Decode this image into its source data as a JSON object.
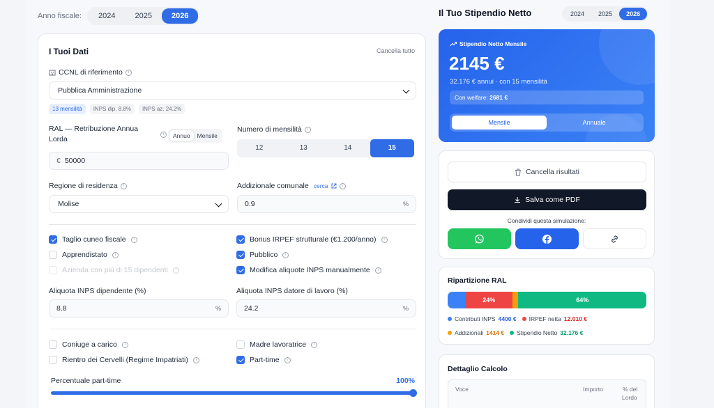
{
  "year_selector": {
    "label": "Anno fiscale:",
    "years": [
      "2024",
      "2025",
      "2026"
    ],
    "active": "2026"
  },
  "data_card": {
    "title": "I Tuoi Dati",
    "clear_all": "Cancella tutto",
    "ccnl": {
      "label": "CCNL di riferimento",
      "value": "Pubblica Amministrazione",
      "tags": [
        "13 mensilità",
        "INPS dip. 8.8%",
        "INPS az. 24.2%"
      ]
    },
    "ral": {
      "label_line1": "RAL — Retribuzione Annua",
      "label_line2": "Lorda",
      "toggle": [
        "Annuo",
        "Mensile"
      ],
      "active": "Annuo",
      "currency": "€",
      "value": "50000"
    },
    "mensilita": {
      "label": "Numero di mensilità",
      "options": [
        "12",
        "13",
        "14",
        "15"
      ],
      "active": "15"
    },
    "regione": {
      "label": "Regione di residenza",
      "value": "Molise"
    },
    "addizionale": {
      "label": "Addizionale comunale",
      "link": "cerca",
      "value": "0.9",
      "suffix": "%"
    },
    "checkboxes_a": [
      {
        "label": "Taglio cuneo fiscale",
        "checked": true
      },
      {
        "label": "Apprendistato",
        "checked": false
      },
      {
        "label": "Azienda con più di 15 dipendenti",
        "checked": false,
        "disabled": true
      },
      {
        "label": "Bonus IRPEF strutturale (€1.200/anno)",
        "checked": true
      },
      {
        "label": "Pubblico",
        "checked": true
      },
      {
        "label": "Modifica aliquote INPS manualmente",
        "checked": true
      }
    ],
    "inps_dip": {
      "label": "Aliquota INPS dipendente (%)",
      "value": "8.8",
      "suffix": "%"
    },
    "inps_az": {
      "label": "Aliquota INPS datore di lavoro (%)",
      "value": "24.2",
      "suffix": "%"
    },
    "checkboxes_b": [
      {
        "label": "Coniuge a carico",
        "checked": false
      },
      {
        "label": "Rientro dei Cervelli (Regime Impatriati)",
        "checked": false
      },
      {
        "label": "Madre lavoratrice",
        "checked": false
      },
      {
        "label": "Part-time",
        "checked": true
      }
    ],
    "part_time": {
      "label": "Percentuale part-time",
      "value": "100%",
      "level": 1.0
    }
  },
  "result": {
    "title": "Il Tuo Stipendio Netto",
    "years": [
      "2024",
      "2025",
      "2026"
    ],
    "active_year": "2026",
    "blue_card": {
      "label": "Stipendio Netto Mensile",
      "amount": "2145 €",
      "sub": "32.176 € annui · con 15 mensilità",
      "welfare_prefix": "Con welfare:",
      "welfare_value": "2681 €",
      "toggle": [
        "Mensile",
        "Annuale"
      ],
      "active": "Mensile"
    },
    "actions": {
      "clear": "Cancella risultati",
      "pdf": "Salva come PDF",
      "share_label": "Condividi questa simulazione:"
    },
    "ripartizione": {
      "title": "Ripartizione RAL",
      "segments": [
        {
          "name": "Contributi INPS",
          "value": "4400 €",
          "percent": 8.8,
          "label": "",
          "color": "#3b82f6"
        },
        {
          "name": "IRPEF netta",
          "value": "12.010 €",
          "percent": 24,
          "label": "24%",
          "color": "#ef4444"
        },
        {
          "name": "Addizionali",
          "value": "1414 €",
          "percent": 2.8,
          "label": "",
          "color": "#f59e0b"
        },
        {
          "name": "Stipendio Netto",
          "value": "32.176 €",
          "percent": 64.4,
          "label": "64%",
          "color": "#10b981"
        }
      ]
    },
    "dettaglio": {
      "title": "Dettaglio Calcolo",
      "headers": [
        "Voce",
        "Importo",
        "% del",
        "Lordo"
      ]
    }
  }
}
